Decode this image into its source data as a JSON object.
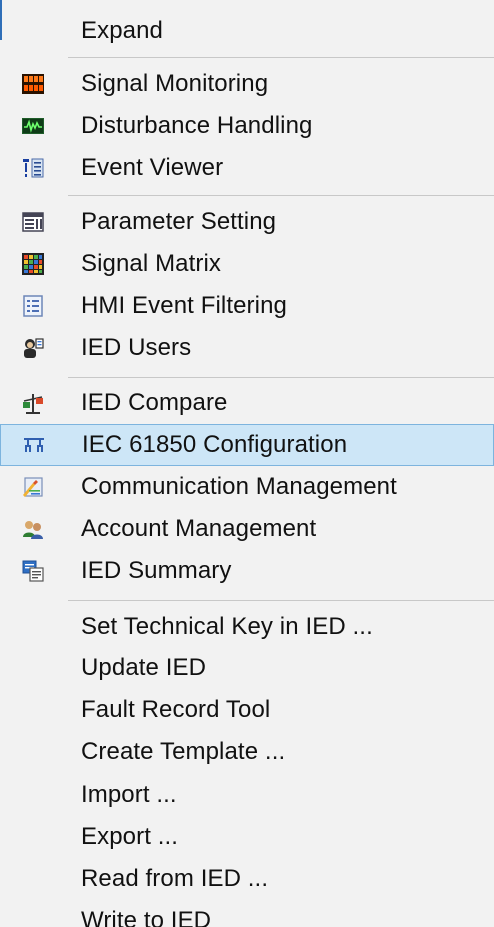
{
  "menu": {
    "items": [
      {
        "label": "Expand"
      },
      {
        "label": "Signal Monitoring",
        "icon": "signal-monitoring-icon"
      },
      {
        "label": "Disturbance Handling",
        "icon": "disturbance-handling-icon"
      },
      {
        "label": "Event Viewer",
        "icon": "event-viewer-icon"
      },
      {
        "label": "Parameter Setting",
        "icon": "parameter-setting-icon"
      },
      {
        "label": "Signal Matrix",
        "icon": "signal-matrix-icon"
      },
      {
        "label": "HMI Event Filtering",
        "icon": "hmi-event-filtering-icon"
      },
      {
        "label": "IED Users",
        "icon": "ied-users-icon"
      },
      {
        "label": "IED Compare",
        "icon": "ied-compare-icon"
      },
      {
        "label": "IEC 61850 Configuration",
        "icon": "iec-61850-configuration-icon",
        "selected": true
      },
      {
        "label": "Communication Management",
        "icon": "communication-management-icon"
      },
      {
        "label": "Account Management",
        "icon": "account-management-icon"
      },
      {
        "label": "IED Summary",
        "icon": "ied-summary-icon"
      },
      {
        "label": "Set Technical Key in IED ..."
      },
      {
        "label": "Update IED"
      },
      {
        "label": "Fault Record Tool"
      },
      {
        "label": "Create Template ..."
      },
      {
        "label": "Import ..."
      },
      {
        "label": "Export ..."
      },
      {
        "label": "Read from IED ..."
      },
      {
        "label": "Write to IED"
      }
    ]
  },
  "colors": {
    "menu_background": "#f2f2f2",
    "selection_fill": "#cde6f7",
    "selection_border": "#7db4de",
    "separator": "#c8c8c8",
    "text": "#111111"
  }
}
